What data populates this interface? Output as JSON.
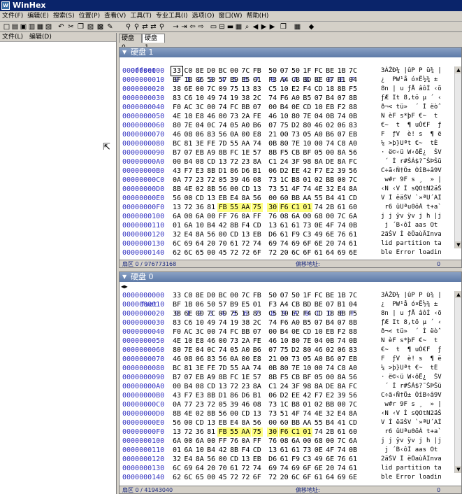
{
  "window": {
    "title": "WinHex"
  },
  "menu": [
    "文件(F)",
    "编辑(E)",
    "搜索(S)",
    "位置(P)",
    "查看(V)",
    "工具(T)",
    "专业工具(I)",
    "选项(O)",
    "窗口(W)",
    "帮助(H)"
  ],
  "toolbar_icons": [
    "new-icon",
    "open-icon",
    "save-icon",
    "print-icon",
    "properties-icon",
    "open-folder-icon",
    "undo-icon",
    "cut-icon",
    "copy-icon",
    "paste-icon",
    "paste-special-icon",
    "write-icon",
    "find-icon",
    "find-hex-icon",
    "replace-icon",
    "replace-hex-icon",
    "find-next-icon",
    "goto-offset-icon",
    "goto-sector-icon",
    "back-icon",
    "forward-icon",
    "open-disk-icon",
    "disk-editor-icon",
    "ram-icon",
    "calculator-icon",
    "search-icon",
    "prev-icon",
    "play-icon",
    "next-icon",
    "window-icon",
    "table-icon",
    "settings-icon"
  ],
  "left_panel": {
    "menu": [
      "文件(L)",
      "编辑(D)"
    ]
  },
  "tabs": [
    {
      "label": "硬盘 0"
    },
    {
      "label": "硬盘 1"
    }
  ],
  "hex_header": {
    "offset_label": "Offset",
    "columns": [
      "0",
      "1",
      "2",
      "3",
      "4",
      "5",
      "6",
      "7",
      "8",
      "9",
      "A",
      "B",
      "C",
      "D",
      "E",
      "F"
    ]
  },
  "panel1": {
    "title": "硬盘 1",
    "status_left": "扇区 0 / 976773168",
    "status_mid": "偏移地址:",
    "status_right": "0",
    "rows": [
      {
        "addr": "0000000000",
        "bytes": [
          "33",
          "C0",
          "8E",
          "D0",
          "BC",
          "00",
          "7C",
          "FB",
          "50",
          "07",
          "50",
          "1F",
          "FC",
          "BE",
          "1B",
          "7C"
        ],
        "text": "3ÀŽÐ¼ |ûP P ü¾ |"
      },
      {
        "addr": "0000000010",
        "bytes": [
          "BF",
          "1B",
          "06",
          "50",
          "57",
          "B9",
          "E5",
          "01",
          "F3",
          "A4",
          "CB",
          "BD",
          "BE",
          "07",
          "B1",
          "04"
        ],
        "text": "¿  PW¹å ó¤Ë½¾ ± "
      },
      {
        "addr": "0000000020",
        "bytes": [
          "38",
          "6E",
          "00",
          "7C",
          "09",
          "75",
          "13",
          "83",
          "C5",
          "10",
          "E2",
          "F4",
          "CD",
          "18",
          "8B",
          "F5"
        ],
        "text": "8n | u ƒÅ âôÍ ‹õ"
      },
      {
        "addr": "0000000030",
        "bytes": [
          "83",
          "C6",
          "10",
          "49",
          "74",
          "19",
          "38",
          "2C",
          "74",
          "F6",
          "A0",
          "B5",
          "07",
          "B4",
          "07",
          "8B"
        ],
        "text": "ƒÆ It 8,tö µ ´ ‹"
      },
      {
        "addr": "0000000040",
        "bytes": [
          "F0",
          "AC",
          "3C",
          "00",
          "74",
          "FC",
          "BB",
          "07",
          "00",
          "B4",
          "0E",
          "CD",
          "10",
          "EB",
          "F2",
          "88"
        ],
        "text": "ð¬< tü»  ´ Í ëòˆ"
      },
      {
        "addr": "0000000050",
        "bytes": [
          "4E",
          "10",
          "E8",
          "46",
          "00",
          "73",
          "2A",
          "FE",
          "46",
          "10",
          "80",
          "7E",
          "04",
          "0B",
          "74",
          "0B"
        ],
        "text": "N èF s*þF €~  t "
      },
      {
        "addr": "0000000060",
        "bytes": [
          "80",
          "7E",
          "04",
          "0C",
          "74",
          "05",
          "A0",
          "B6",
          "07",
          "75",
          "D2",
          "80",
          "46",
          "02",
          "06",
          "83"
        ],
        "text": "€~  t  ¶ uÒ€F  ƒ"
      },
      {
        "addr": "0000000070",
        "bytes": [
          "46",
          "08",
          "06",
          "83",
          "56",
          "0A",
          "00",
          "E8",
          "21",
          "00",
          "73",
          "05",
          "A0",
          "B6",
          "07",
          "EB"
        ],
        "text": "F  ƒV  è! s  ¶ ë"
      },
      {
        "addr": "0000000080",
        "bytes": [
          "BC",
          "81",
          "3E",
          "FE",
          "7D",
          "55",
          "AA",
          "74",
          "0B",
          "80",
          "7E",
          "10",
          "00",
          "74",
          "C8",
          "A0"
        ],
        "text": "¼ >þ}Uªt €~  tÈ "
      },
      {
        "addr": "0000000090",
        "bytes": [
          "B7",
          "07",
          "EB",
          "A9",
          "8B",
          "FC",
          "1E",
          "57",
          "8B",
          "F5",
          "CB",
          "BF",
          "05",
          "00",
          "8A",
          "56"
        ],
        "text": "· ë©‹ü W‹õË¿  ŠV"
      },
      {
        "addr": "00000000A0",
        "bytes": [
          "00",
          "B4",
          "08",
          "CD",
          "13",
          "72",
          "23",
          "8A",
          "C1",
          "24",
          "3F",
          "98",
          "8A",
          "DE",
          "8A",
          "FC"
        ],
        "text": " ´ Í r#ŠÁ$?˜ŠÞŠü"
      },
      {
        "addr": "00000000B0",
        "bytes": [
          "43",
          "F7",
          "E3",
          "8B",
          "D1",
          "86",
          "D6",
          "B1",
          "06",
          "D2",
          "EE",
          "42",
          "F7",
          "E2",
          "39",
          "56"
        ],
        "text": "C÷ã‹Ñ†Ö± ÒîB÷â9V"
      },
      {
        "addr": "00000000C0",
        "bytes": [
          "0A",
          "77",
          "23",
          "72",
          "05",
          "39",
          "46",
          "08",
          "73",
          "1C",
          "B8",
          "01",
          "02",
          "BB",
          "00",
          "7C"
        ],
        "text": " w#r 9F s ¸  » |"
      },
      {
        "addr": "00000000D0",
        "bytes": [
          "8B",
          "4E",
          "02",
          "8B",
          "56",
          "00",
          "CD",
          "13",
          "73",
          "51",
          "4F",
          "74",
          "4E",
          "32",
          "E4",
          "8A"
        ],
        "text": "‹N ‹V Í sQOtN2äŠ"
      },
      {
        "addr": "00000000E0",
        "bytes": [
          "56",
          "00",
          "CD",
          "13",
          "EB",
          "E4",
          "8A",
          "56",
          "00",
          "60",
          "BB",
          "AA",
          "55",
          "B4",
          "41",
          "CD"
        ],
        "text": "V Í ëäŠV `»ªU´AÍ"
      },
      {
        "addr": "00000000F0",
        "bytes": [
          "13",
          "72",
          "36",
          "81",
          "FB",
          "55",
          "AA",
          "75",
          "30",
          "F6",
          "C1",
          "01",
          "74",
          "2B",
          "61",
          "60"
        ],
        "text": " r6 ûUªu0öÁ t+a`"
      },
      {
        "addr": "0000000100",
        "bytes": [
          "6A",
          "00",
          "6A",
          "00",
          "FF",
          "76",
          "0A",
          "FF",
          "76",
          "08",
          "6A",
          "00",
          "68",
          "00",
          "7C",
          "6A"
        ],
        "text": "j j ÿv ÿv j h |j"
      },
      {
        "addr": "0000000110",
        "bytes": [
          "01",
          "6A",
          "10",
          "B4",
          "42",
          "8B",
          "F4",
          "CD",
          "13",
          "61",
          "61",
          "73",
          "0E",
          "4F",
          "74",
          "0B"
        ],
        "text": " j ´B‹ôÍ aas Ot "
      },
      {
        "addr": "0000000120",
        "bytes": [
          "32",
          "E4",
          "8A",
          "56",
          "00",
          "CD",
          "13",
          "EB",
          "D6",
          "61",
          "F9",
          "C3",
          "49",
          "6E",
          "76",
          "61"
        ],
        "text": "2äŠV Í ëÖaùÃInva"
      },
      {
        "addr": "0000000130",
        "bytes": [
          "6C",
          "69",
          "64",
          "20",
          "70",
          "61",
          "72",
          "74",
          "69",
          "74",
          "69",
          "6F",
          "6E",
          "20",
          "74",
          "61"
        ],
        "text": "lid partition ta"
      },
      {
        "addr": "0000000140",
        "bytes": [
          "62",
          "6C",
          "65",
          "00",
          "45",
          "72",
          "72",
          "6F",
          "72",
          "20",
          "6C",
          "6F",
          "61",
          "64",
          "69",
          "6E"
        ],
        "text": "ble Error loadin"
      }
    ]
  },
  "panel2": {
    "title": "硬盘 0",
    "status_left": "扇区 0 / 41943040",
    "status_mid": "偏移地址:",
    "status_right": "0",
    "offset_label": "fset",
    "rows": [
      {
        "addr": "0000000000",
        "bytes": [
          "33",
          "C0",
          "8E",
          "D0",
          "BC",
          "00",
          "7C",
          "FB",
          "50",
          "07",
          "50",
          "1F",
          "FC",
          "BE",
          "1B",
          "7C"
        ],
        "text": "3ÀŽÐ¼ |ûP P ü¾ |"
      },
      {
        "addr": "0000000010",
        "bytes": [
          "BF",
          "1B",
          "06",
          "50",
          "57",
          "B9",
          "E5",
          "01",
          "F3",
          "A4",
          "CB",
          "BD",
          "BE",
          "07",
          "B1",
          "04"
        ],
        "text": "¿  PW¹å ó¤Ë½¾ ± "
      },
      {
        "addr": "0000000020",
        "bytes": [
          "38",
          "6E",
          "00",
          "7C",
          "09",
          "75",
          "13",
          "83",
          "C5",
          "10",
          "E2",
          "F4",
          "CD",
          "18",
          "8B",
          "F5"
        ],
        "text": "8n | u ƒÅ âôÍ ‹õ"
      },
      {
        "addr": "0000000030",
        "bytes": [
          "83",
          "C6",
          "10",
          "49",
          "74",
          "19",
          "38",
          "2C",
          "74",
          "F6",
          "A0",
          "B5",
          "07",
          "B4",
          "07",
          "8B"
        ],
        "text": "ƒÆ It 8,tö µ ´ ‹"
      },
      {
        "addr": "0000000040",
        "bytes": [
          "F0",
          "AC",
          "3C",
          "00",
          "74",
          "FC",
          "BB",
          "07",
          "00",
          "B4",
          "0E",
          "CD",
          "10",
          "EB",
          "F2",
          "88"
        ],
        "text": "ð¬< tü»  ´ Í ëòˆ"
      },
      {
        "addr": "0000000050",
        "bytes": [
          "4E",
          "10",
          "E8",
          "46",
          "00",
          "73",
          "2A",
          "FE",
          "46",
          "10",
          "80",
          "7E",
          "04",
          "0B",
          "74",
          "0B"
        ],
        "text": "N èF s*þF €~  t "
      },
      {
        "addr": "0000000060",
        "bytes": [
          "80",
          "7E",
          "04",
          "0C",
          "74",
          "05",
          "A0",
          "B6",
          "07",
          "75",
          "D2",
          "80",
          "46",
          "02",
          "06",
          "83"
        ],
        "text": "€~  t  ¶ uÒ€F  ƒ"
      },
      {
        "addr": "0000000070",
        "bytes": [
          "46",
          "08",
          "06",
          "83",
          "56",
          "0A",
          "00",
          "E8",
          "21",
          "00",
          "73",
          "05",
          "A0",
          "B6",
          "07",
          "EB"
        ],
        "text": "F  ƒV  è! s  ¶ ë"
      },
      {
        "addr": "0000000080",
        "bytes": [
          "BC",
          "81",
          "3E",
          "FE",
          "7D",
          "55",
          "AA",
          "74",
          "0B",
          "80",
          "7E",
          "10",
          "00",
          "74",
          "C8",
          "A0"
        ],
        "text": "¼ >þ}Uªt €~  tÈ "
      },
      {
        "addr": "0000000090",
        "bytes": [
          "B7",
          "07",
          "EB",
          "A9",
          "8B",
          "FC",
          "1E",
          "57",
          "8B",
          "F5",
          "CB",
          "BF",
          "05",
          "00",
          "8A",
          "56"
        ],
        "text": "· ë©‹ü W‹õË¿  ŠV"
      },
      {
        "addr": "00000000A0",
        "bytes": [
          "00",
          "B4",
          "08",
          "CD",
          "13",
          "72",
          "23",
          "8A",
          "C1",
          "24",
          "3F",
          "98",
          "8A",
          "DE",
          "8A",
          "FC"
        ],
        "text": " ´ Í r#ŠÁ$?˜ŠÞŠü"
      },
      {
        "addr": "00000000B0",
        "bytes": [
          "43",
          "F7",
          "E3",
          "8B",
          "D1",
          "86",
          "D6",
          "B1",
          "06",
          "D2",
          "EE",
          "42",
          "F7",
          "E2",
          "39",
          "56"
        ],
        "text": "C÷ã‹Ñ†Ö± ÒîB÷â9V"
      },
      {
        "addr": "00000000C0",
        "bytes": [
          "0A",
          "77",
          "23",
          "72",
          "05",
          "39",
          "46",
          "08",
          "73",
          "1C",
          "B8",
          "01",
          "02",
          "BB",
          "00",
          "7C"
        ],
        "text": " w#r 9F s ¸  » |"
      },
      {
        "addr": "00000000D0",
        "bytes": [
          "8B",
          "4E",
          "02",
          "8B",
          "56",
          "00",
          "CD",
          "13",
          "73",
          "51",
          "4F",
          "74",
          "4E",
          "32",
          "E4",
          "8A"
        ],
        "text": "‹N ‹V Í sQOtN2äŠ"
      },
      {
        "addr": "00000000E0",
        "bytes": [
          "56",
          "00",
          "CD",
          "13",
          "EB",
          "E4",
          "8A",
          "56",
          "00",
          "60",
          "BB",
          "AA",
          "55",
          "B4",
          "41",
          "CD"
        ],
        "text": "V Í ëäŠV `»ªU´AÍ"
      },
      {
        "addr": "00000000F0",
        "bytes": [
          "13",
          "72",
          "36",
          "81",
          "FB",
          "55",
          "AA",
          "75",
          "30",
          "F6",
          "C1",
          "01",
          "74",
          "2B",
          "61",
          "60"
        ],
        "text": " r6 ûUªu0öÁ t+a`"
      },
      {
        "addr": "0000000100",
        "bytes": [
          "6A",
          "00",
          "6A",
          "00",
          "FF",
          "76",
          "0A",
          "FF",
          "76",
          "08",
          "6A",
          "00",
          "68",
          "00",
          "7C",
          "6A"
        ],
        "text": "j j ÿv ÿv j h |j"
      },
      {
        "addr": "0000000110",
        "bytes": [
          "01",
          "6A",
          "10",
          "B4",
          "42",
          "8B",
          "F4",
          "CD",
          "13",
          "61",
          "61",
          "73",
          "0E",
          "4F",
          "74",
          "0B"
        ],
        "text": " j ´B‹ôÍ aas Ot "
      },
      {
        "addr": "0000000120",
        "bytes": [
          "32",
          "E4",
          "8A",
          "56",
          "00",
          "CD",
          "13",
          "EB",
          "D6",
          "61",
          "F9",
          "C3",
          "49",
          "6E",
          "76",
          "61"
        ],
        "text": "2äŠV Í ëÖaùÃInva"
      },
      {
        "addr": "0000000130",
        "bytes": [
          "6C",
          "69",
          "64",
          "20",
          "70",
          "61",
          "72",
          "74",
          "69",
          "74",
          "69",
          "6F",
          "6E",
          "20",
          "74",
          "61"
        ],
        "text": "lid partition ta"
      },
      {
        "addr": "0000000140",
        "bytes": [
          "62",
          "6C",
          "65",
          "00",
          "45",
          "72",
          "72",
          "6F",
          "72",
          "20",
          "6C",
          "6F",
          "61",
          "64",
          "69",
          "6E"
        ],
        "text": "ble Error loadin"
      }
    ]
  }
}
